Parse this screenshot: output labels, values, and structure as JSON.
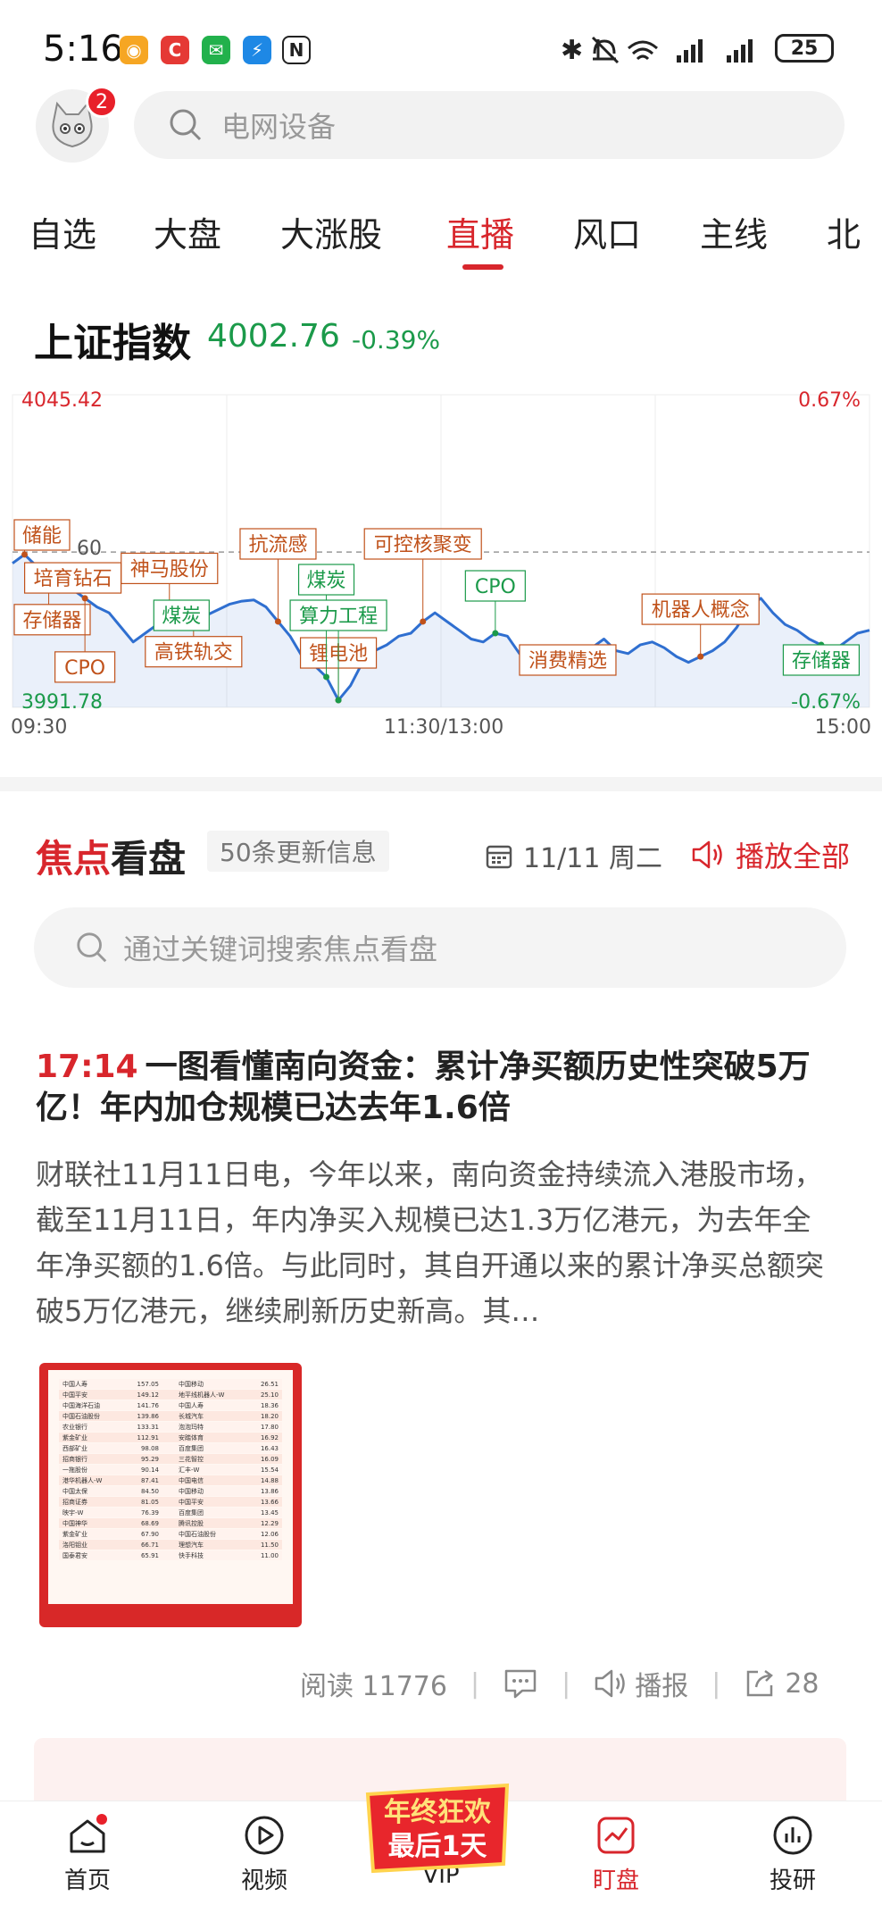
{
  "status_bar": {
    "time": "5:16",
    "battery": "25"
  },
  "header": {
    "notification_count": "2",
    "search_placeholder": "电网设备"
  },
  "tabs": [
    {
      "label": "自选",
      "active": false
    },
    {
      "label": "大盘",
      "active": false
    },
    {
      "label": "大涨股",
      "active": false
    },
    {
      "label": "直播",
      "active": true
    },
    {
      "label": "风口",
      "active": false
    },
    {
      "label": "主线",
      "active": false
    },
    {
      "label": "北",
      "active": false
    }
  ],
  "index": {
    "name": "上证指数",
    "value": "4002.76",
    "change": "-0.39%"
  },
  "chart_data": {
    "type": "line",
    "y_high_label": "4045.42",
    "y_low_label": "3991.78",
    "pct_high_label": "0.67%",
    "pct_low_label": "-0.67%",
    "ref_label": "60",
    "x_ticks": [
      "09:30",
      "11:30/13:00",
      "15:00"
    ],
    "ylim": [
      3991.78,
      4045.42
    ],
    "y_ref": 4018.42,
    "series": [
      {
        "values": [
          4016.5,
          4018.0,
          4016.0,
          4012.5,
          4014.5,
          4012.0,
          4010.5,
          4009.0,
          4008.0,
          4005.5,
          4003.0,
          4004.5,
          4006.0,
          4007.5,
          4008.5,
          4007.0,
          4007.5,
          4008.5,
          4009.5,
          4010.0,
          4010.2,
          4009.0,
          4006.5,
          4004.0,
          4000.5,
          3999.0,
          3997.0,
          3993.0,
          3995.5,
          3999.5,
          4001.5,
          4002.5,
          4004.0,
          4004.5,
          4006.5,
          4008.0,
          4006.5,
          4005.0,
          4003.5,
          4003.0,
          4004.5,
          4004.0,
          4001.0,
          3999.5,
          3998.5,
          3998.0,
          3999.0,
          4000.0,
          4002.0,
          4003.5,
          4001.5,
          4001.0,
          4002.5,
          4003.0,
          4002.0,
          4000.5,
          3999.5,
          4000.5,
          4001.5,
          4003.0,
          4005.5,
          4009.0,
          4010.5,
          4008.0,
          4006.0,
          4005.0,
          4003.5,
          4002.5,
          4001.5,
          4003.0,
          4004.5,
          4005.0
        ]
      }
    ],
    "annotations": [
      {
        "label": "储能",
        "color": "orange",
        "i": 1
      },
      {
        "label": "存储器",
        "color": "orange",
        "i": 3
      },
      {
        "label": "培育钻石",
        "color": "orange",
        "i": 5
      },
      {
        "label": "CPO",
        "color": "orange",
        "i": 6
      },
      {
        "label": "神马股份",
        "color": "orange",
        "i": 13
      },
      {
        "label": "高铁轨交",
        "color": "orange",
        "i": 15
      },
      {
        "label": "煤炭",
        "color": "green",
        "i": 14
      },
      {
        "label": "抗流感",
        "color": "orange",
        "i": 22
      },
      {
        "label": "锂电池",
        "color": "orange",
        "i": 27
      },
      {
        "label": "煤炭",
        "color": "green",
        "i": 26
      },
      {
        "label": "算力工程",
        "color": "green",
        "i": 27
      },
      {
        "label": "可控核聚变",
        "color": "orange",
        "i": 34
      },
      {
        "label": "CPO",
        "color": "green",
        "i": 40
      },
      {
        "label": "消费精选",
        "color": "orange",
        "i": 46
      },
      {
        "label": "机器人概念",
        "color": "orange",
        "i": 57
      },
      {
        "label": "存储器",
        "color": "green",
        "i": 67
      }
    ]
  },
  "focus": {
    "title_red": "焦点",
    "title_black": "看盘",
    "count": "50条更新信息",
    "date": "11/11 周二",
    "play_all": "播放全部",
    "search_placeholder": "通过关键词搜索焦点看盘"
  },
  "news": {
    "time": "17:14",
    "title": "一图看懂南向资金：累计净买额历史性突破5万亿！年内加仓规模已达去年1.6倍",
    "body": "财联社11月11日电，今年以来，南向资金持续流入港股市场，截至11月11日，年内净买入规模已达1.3万亿港元，为去年全年净买额的1.6倍。与此同时，其自开通以来的累计净买总额突破5万亿港元，继续刷新历史新高。其…",
    "table_left": [
      [
        "中国人寿",
        "157.05"
      ],
      [
        "中国平安",
        "149.12"
      ],
      [
        "中国海洋石油",
        "141.76"
      ],
      [
        "中国石油股份",
        "139.86"
      ],
      [
        "农业银行",
        "133.31"
      ],
      [
        "紫金矿业",
        "112.91"
      ],
      [
        "西部矿业",
        "98.08"
      ],
      [
        "招商银行",
        "95.29"
      ],
      [
        "一拖股份",
        "90.14"
      ],
      [
        "港华机器人-W",
        "87.41"
      ],
      [
        "中国太保",
        "84.50"
      ],
      [
        "招商证券",
        "81.05"
      ],
      [
        "映宇-W",
        "76.39"
      ],
      [
        "中国神华",
        "68.69"
      ],
      [
        "紫金矿业",
        "67.90"
      ],
      [
        "洛阳钼业",
        "66.71"
      ],
      [
        "国泰君安",
        "65.91"
      ]
    ],
    "table_right": [
      [
        "中国移动",
        "26.51"
      ],
      [
        "地平线机器人-W",
        "25.10"
      ],
      [
        "中国人寿",
        "18.36"
      ],
      [
        "长城汽车",
        "18.20"
      ],
      [
        "泡泡玛特",
        "17.80"
      ],
      [
        "安踏体育",
        "16.92"
      ],
      [
        "百度集团",
        "16.43"
      ],
      [
        "三花智控",
        "16.09"
      ],
      [
        "汇丰-W",
        "15.54"
      ],
      [
        "中国电信",
        "14.88"
      ],
      [
        "中国移动",
        "13.86"
      ],
      [
        "中国平安",
        "13.66"
      ],
      [
        "百度集团",
        "13.45"
      ],
      [
        "腾讯控股",
        "12.29"
      ],
      [
        "中国石油股份",
        "12.06"
      ],
      [
        "理想汽车",
        "11.50"
      ],
      [
        "快手科技",
        "11.00"
      ]
    ],
    "read_label": "阅读 11776",
    "broadcast_label": "播报",
    "share_count": "28"
  },
  "bottom_nav": [
    {
      "label": "首页",
      "active": false
    },
    {
      "label": "视频",
      "active": false
    },
    {
      "label": "VIP",
      "active": false
    },
    {
      "label": "盯盘",
      "active": true
    },
    {
      "label": "投研",
      "active": false
    }
  ],
  "promo": {
    "line1": "年终狂欢",
    "line2": "最后1天"
  },
  "colors": {
    "red": "#d8262c",
    "green": "#1b9a4a",
    "line": "#2f6fd0"
  }
}
